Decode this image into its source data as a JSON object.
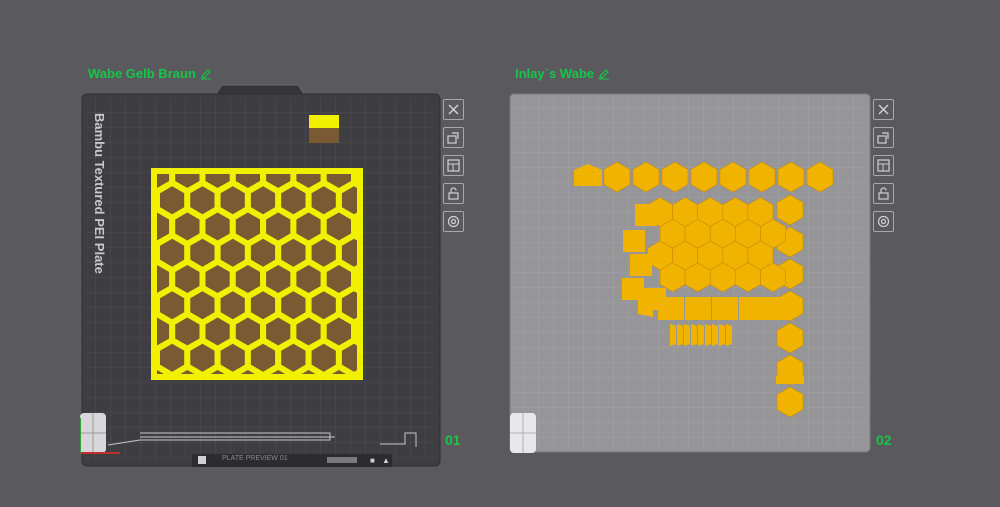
{
  "plates": [
    {
      "title": "Wabe Gelb Braun",
      "number": "01",
      "bed_label": "Bambu Textured PEI Plate",
      "status_text": "PLATE PREVIEW 01"
    },
    {
      "title": "Inlay`s Wabe",
      "number": "02"
    }
  ],
  "toolbar_icons": [
    "close-icon",
    "auto-orient-icon",
    "arrange-icon",
    "lock-icon",
    "settings-icon"
  ],
  "colors": {
    "accent": "#17c54a",
    "yellow": "#f0f000",
    "brown": "#7a5a32",
    "orange": "#f0b400",
    "bed_dark": "#3e3e42",
    "bed_light": "#9a9a9e"
  }
}
